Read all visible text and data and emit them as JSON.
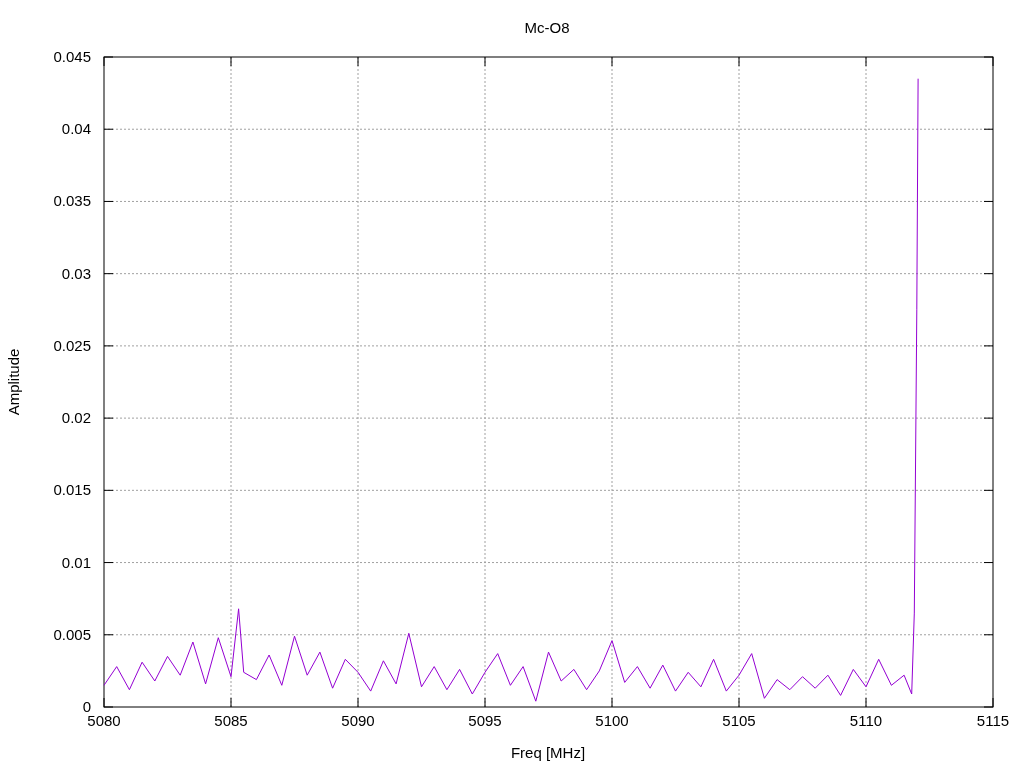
{
  "chart_data": {
    "type": "line",
    "grid": true,
    "title": "Mc-O8",
    "xlabel": "Freq [MHz]",
    "ylabel": "Amplitude",
    "xlim": [
      5080,
      5115
    ],
    "ylim": [
      0,
      0.045
    ],
    "xticks": [
      5080,
      5085,
      5090,
      5095,
      5100,
      5105,
      5110,
      5115
    ],
    "yticks": [
      0,
      0.005,
      0.01,
      0.015,
      0.02,
      0.025,
      0.03,
      0.035,
      0.04,
      0.045
    ],
    "x": [
      5080,
      5080.5,
      5081,
      5081.5,
      5082,
      5082.5,
      5083,
      5083.5,
      5084,
      5084.5,
      5085,
      5085.3,
      5085.5,
      5086,
      5086.5,
      5087,
      5087.5,
      5088,
      5088.5,
      5089,
      5089.5,
      5090,
      5090.5,
      5091,
      5091.5,
      5092,
      5092.5,
      5093,
      5093.5,
      5094,
      5094.5,
      5095,
      5095.5,
      5096,
      5096.5,
      5097,
      5097.5,
      5098,
      5098.5,
      5099,
      5099.5,
      5100,
      5100.5,
      5101,
      5101.5,
      5102,
      5102.5,
      5103,
      5103.5,
      5104,
      5104.5,
      5105,
      5105.5,
      5106,
      5106.5,
      5107,
      5107.5,
      5108,
      5108.5,
      5109,
      5109.5,
      5110,
      5110.5,
      5111,
      5111.5,
      5111.8,
      5111.9,
      5112,
      5112.05
    ],
    "series": [
      {
        "color": "#9400d3",
        "values": [
          0.0015,
          0.0028,
          0.0012,
          0.0031,
          0.0018,
          0.0035,
          0.0022,
          0.0045,
          0.0016,
          0.0048,
          0.0021,
          0.0068,
          0.0024,
          0.0019,
          0.0036,
          0.0015,
          0.0049,
          0.0022,
          0.0038,
          0.0013,
          0.0033,
          0.0024,
          0.0011,
          0.0032,
          0.0016,
          0.0051,
          0.0014,
          0.0028,
          0.0012,
          0.0026,
          0.0009,
          0.0024,
          0.0037,
          0.0015,
          0.0028,
          0.0004,
          0.0038,
          0.0018,
          0.0026,
          0.0012,
          0.0025,
          0.0046,
          0.0017,
          0.0028,
          0.0013,
          0.0029,
          0.0011,
          0.0024,
          0.0014,
          0.0033,
          0.0011,
          0.0022,
          0.0037,
          0.0006,
          0.0019,
          0.0012,
          0.0021,
          0.0013,
          0.0022,
          0.0008,
          0.0026,
          0.0014,
          0.0033,
          0.0015,
          0.0022,
          0.0009,
          0.0065,
          0.0275,
          0.0435
        ]
      }
    ]
  }
}
